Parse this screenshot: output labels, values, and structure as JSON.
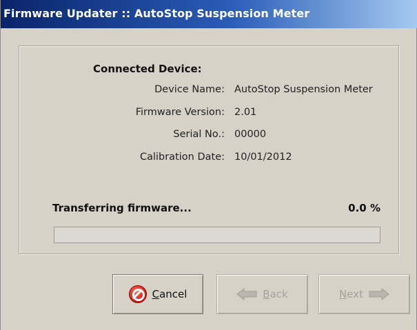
{
  "window": {
    "title": "Firmware Updater :: AutoStop Suspension Meter"
  },
  "device": {
    "heading": "Connected Device:",
    "rows": [
      {
        "label": "Device Name:",
        "value": "AutoStop Suspension Meter"
      },
      {
        "label": "Firmware Version:",
        "value": "2.01"
      },
      {
        "label": "Serial No.:",
        "value": "00000"
      },
      {
        "label": "Calibration Date:",
        "value": "10/01/2012"
      }
    ]
  },
  "transfer": {
    "status": "Transferring firmware...",
    "percent_label": "0.0 %",
    "progress_fraction": 0.0
  },
  "buttons": {
    "cancel": {
      "mnemonic": "C",
      "rest": "ancel",
      "enabled": true,
      "icon": "cancel-icon"
    },
    "back": {
      "mnemonic": "B",
      "rest": "ack",
      "enabled": false,
      "icon": "arrow-left-icon"
    },
    "next": {
      "mnemonic": "N",
      "rest": "ext",
      "enabled": false,
      "icon": "arrow-right-icon"
    }
  },
  "colors": {
    "title_bar_start": "#0a246a",
    "title_bar_end": "#a6caf0",
    "dialog_face": "#d6d2c8",
    "cancel_icon": "#d0160c",
    "disabled_text": "#a3a19b"
  }
}
